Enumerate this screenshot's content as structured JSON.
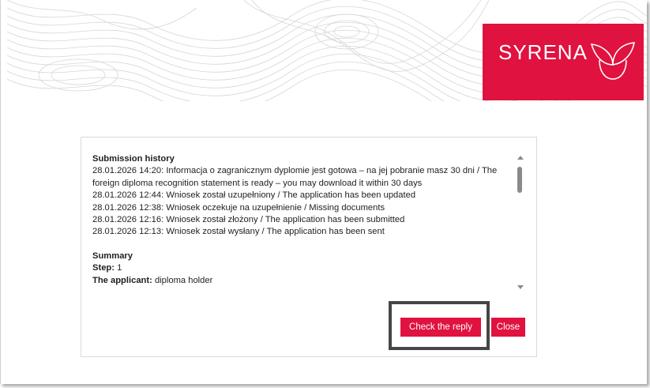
{
  "brand": {
    "name": "SYRENA",
    "accent_color": "#e0123f"
  },
  "modal": {
    "history_heading": "Submission history",
    "history": [
      "28.01.2026 14:20: Informacja o zagranicznym dyplomie jest gotowa – na jej pobranie masz 30 dni / The",
      "foreign diploma recognition statement is ready – you may download it within 30 days",
      "28.01.2026 12:44: Wniosek został uzupełniony / The application has been updated",
      "28.01.2026 12:38: Wniosek oczekuje na uzupełnienie / Missing documents",
      "28.01.2026 12:16: Wniosek został złożony / The application has been submitted",
      "28.01.2026 12:13: Wniosek został wysłany / The application has been sent"
    ],
    "summary_heading": "Summary",
    "step_label": "Step:",
    "step_value": " 1",
    "applicant_label": "The applicant:",
    "applicant_value": " diploma holder",
    "check_reply_label": "Check the reply",
    "close_label": "Close"
  }
}
